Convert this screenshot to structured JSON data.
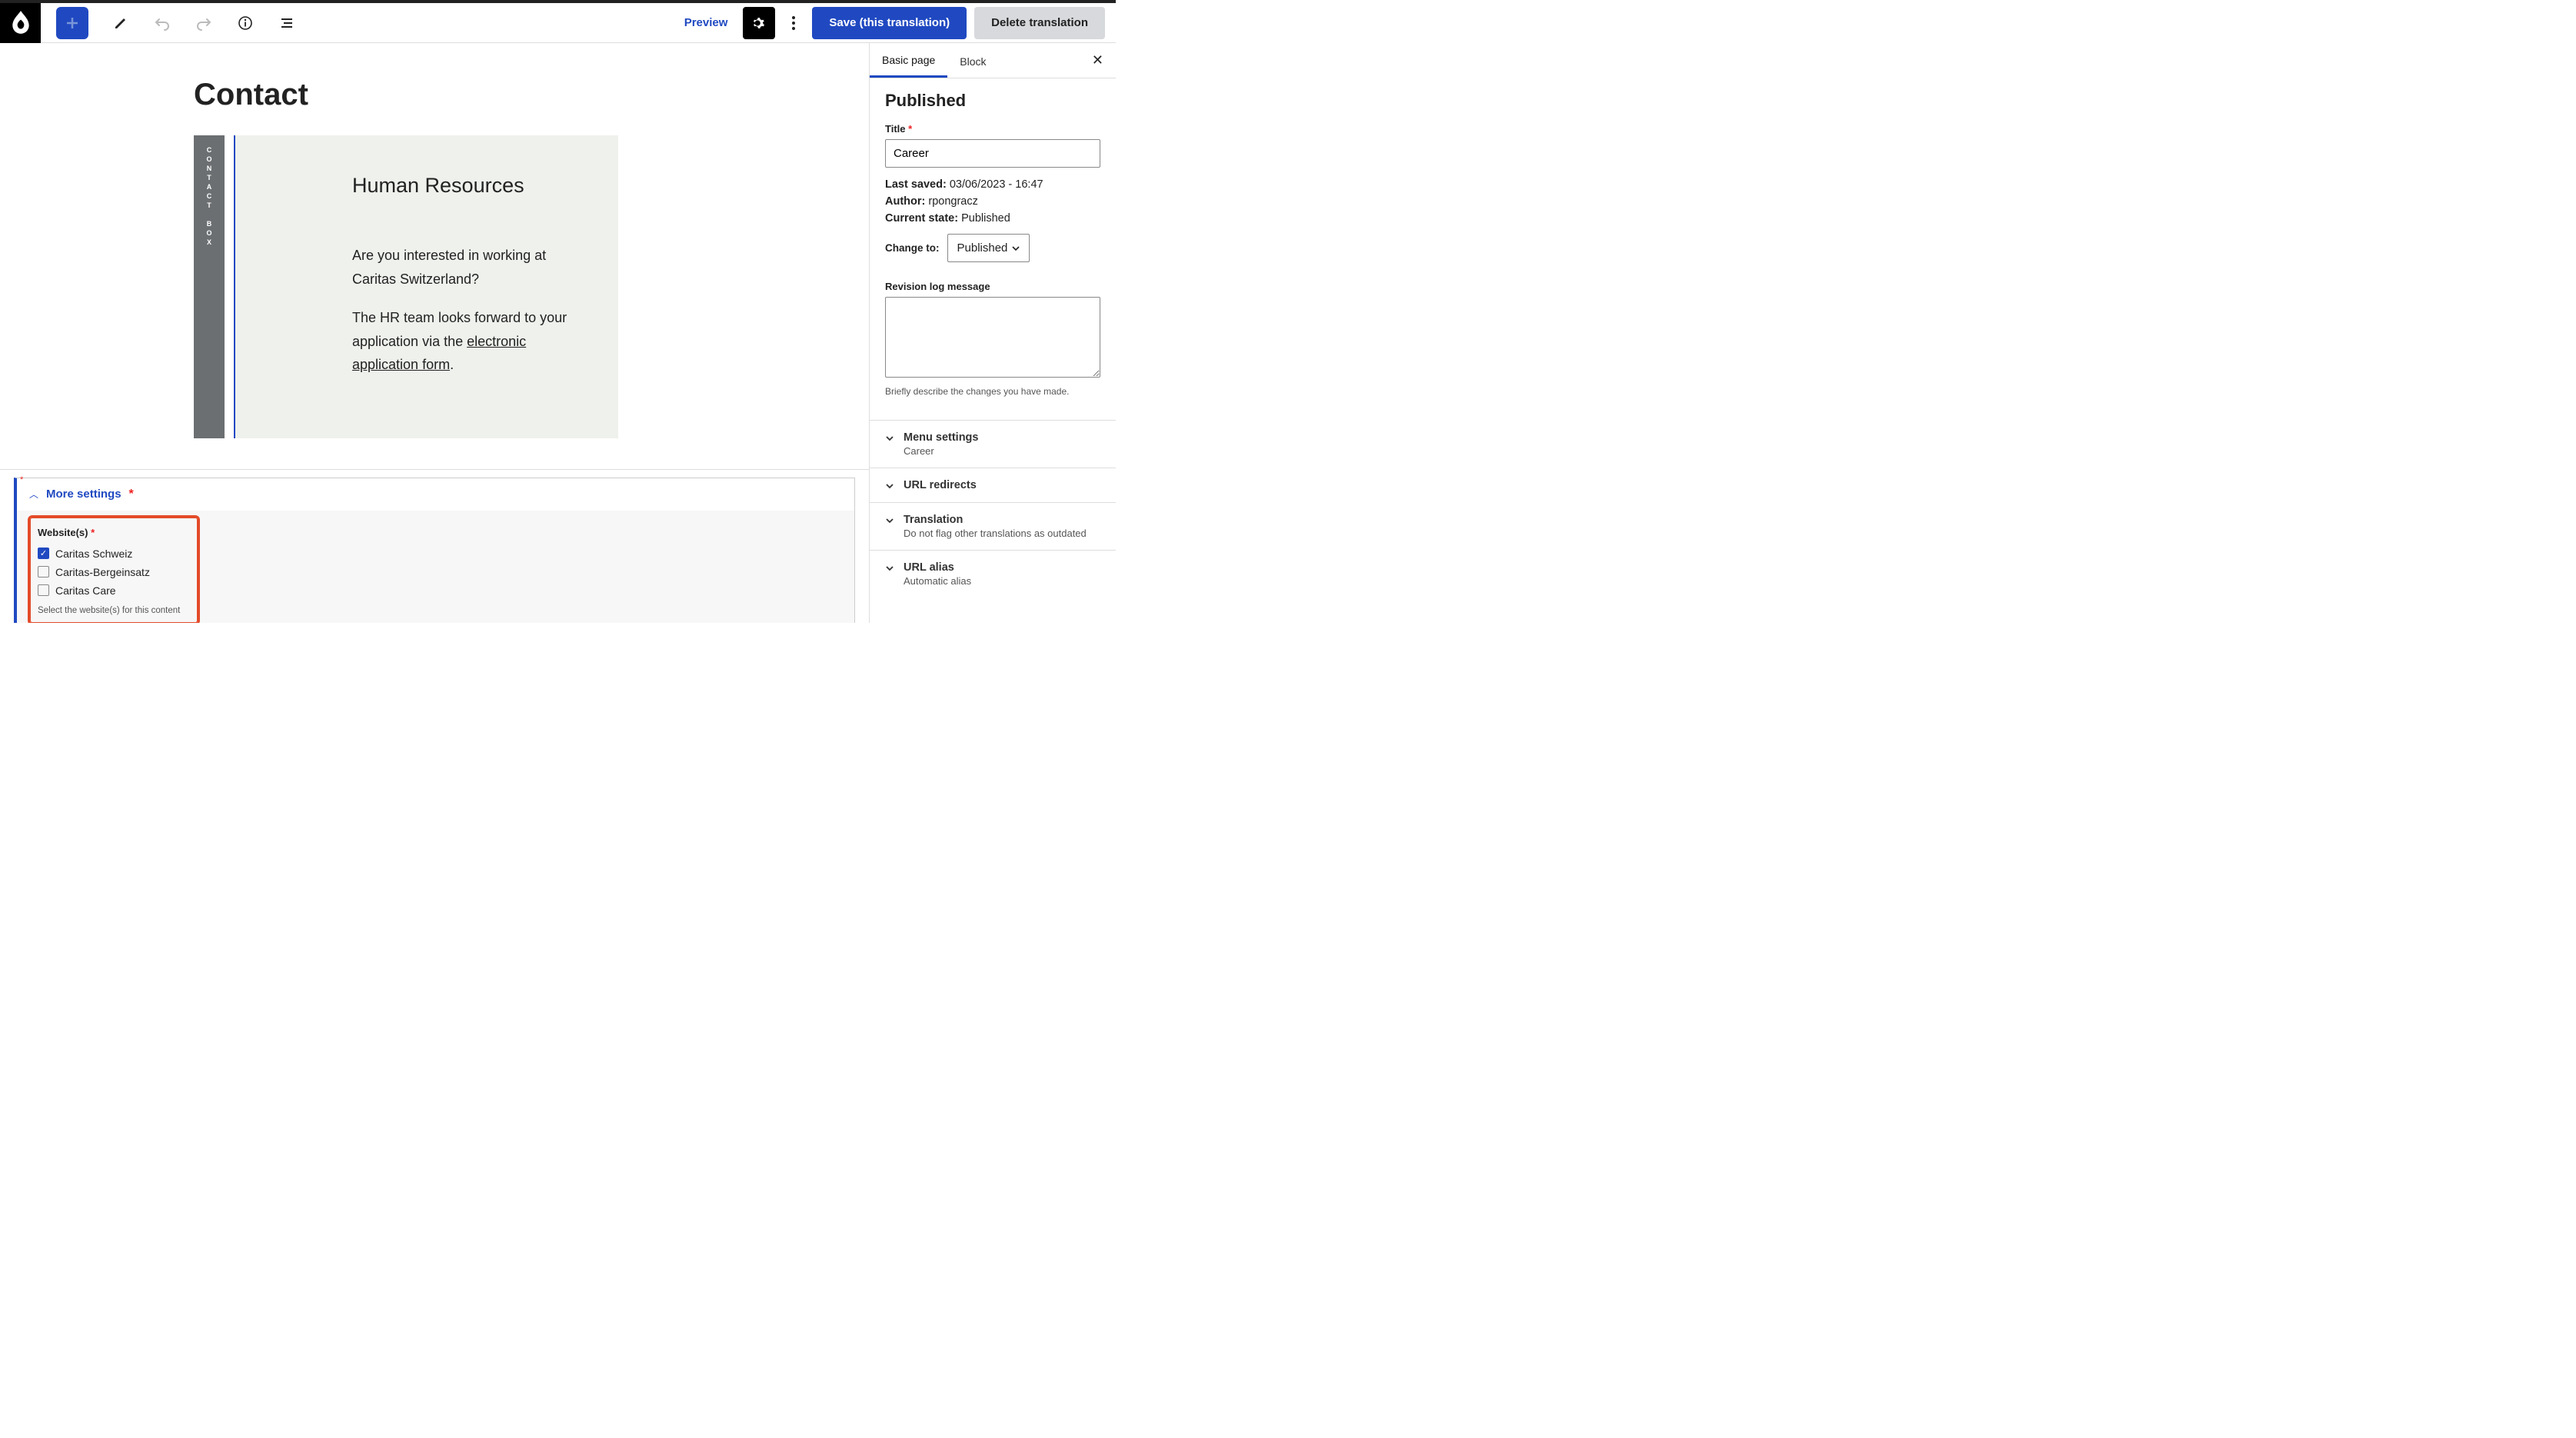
{
  "toolbar": {
    "preview_label": "Preview",
    "save_label": "Save (this translation)",
    "delete_label": "Delete translation"
  },
  "canvas": {
    "page_title": "Contact",
    "contact_block": {
      "vertical_label": "CONTACT BOX",
      "heading": "Human Resources",
      "para1": "Are you interested in working at Caritas Switzerland?",
      "para2_prefix": "The HR team looks forward to your application via the ",
      "para2_link": "electronic application form",
      "para2_suffix": "."
    }
  },
  "more_settings": {
    "header": "More settings",
    "websites": {
      "label": "Website(s)",
      "options": [
        {
          "label": "Caritas Schweiz",
          "checked": true
        },
        {
          "label": "Caritas-Bergeinsatz",
          "checked": false
        },
        {
          "label": "Caritas Care",
          "checked": false
        }
      ],
      "hint": "Select the website(s) for this content"
    }
  },
  "sidebar": {
    "tabs": {
      "basic": "Basic page",
      "block": "Block"
    },
    "status_heading": "Published",
    "title_label": "Title",
    "title_value": "Career",
    "last_saved_label": "Last saved:",
    "last_saved_value": "03/06/2023 - 16:47",
    "author_label": "Author:",
    "author_value": "rpongracz",
    "current_state_label": "Current state:",
    "current_state_value": "Published",
    "change_to_label": "Change to:",
    "change_to_value": "Published",
    "revision_label": "Revision log message",
    "revision_hint": "Briefly describe the changes you have made.",
    "accordions": {
      "menu": {
        "title": "Menu settings",
        "sub": "Career"
      },
      "url_redirects": {
        "title": "URL redirects"
      },
      "translation": {
        "title": "Translation",
        "sub": "Do not flag other translations as outdated"
      },
      "url_alias": {
        "title": "URL alias",
        "sub": "Automatic alias"
      }
    }
  }
}
